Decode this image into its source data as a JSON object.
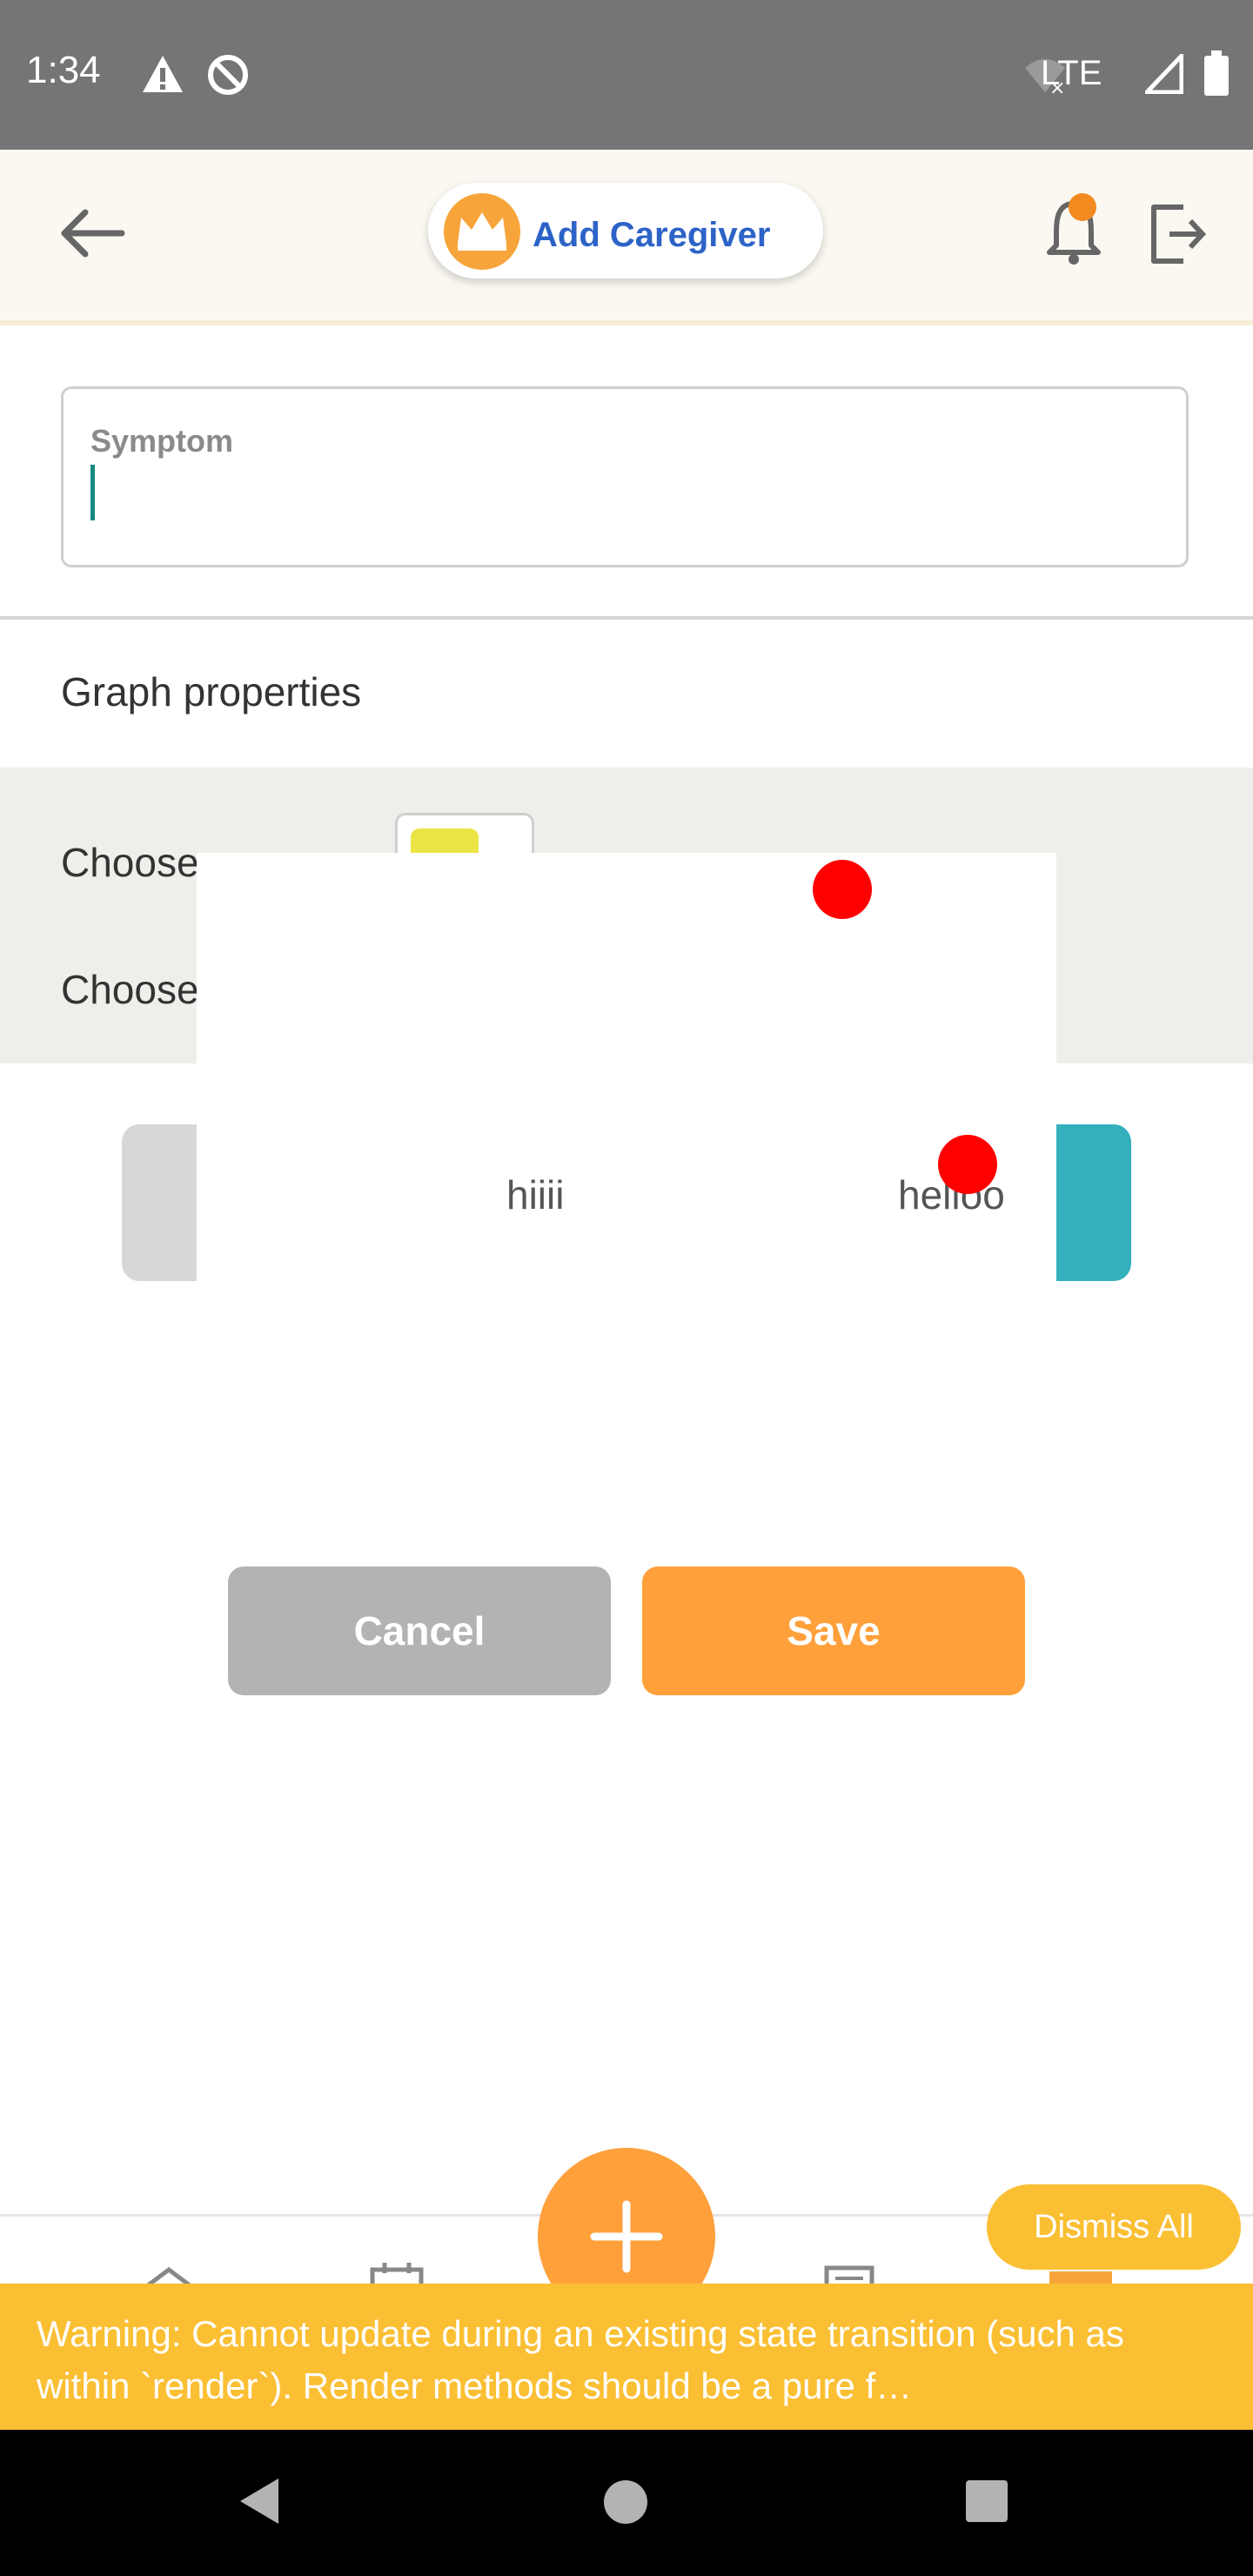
{
  "status_bar": {
    "time": "1:34",
    "network": "LTE",
    "icons": [
      "warning-icon",
      "no-sync-icon",
      "wifi-off-icon",
      "signal-icon",
      "battery-icon"
    ]
  },
  "header": {
    "back_icon": "back-arrow-icon",
    "add_caregiver_label": "Add Caregiver",
    "crown_icon": "crown-icon",
    "bell_icon": "bell-icon",
    "logout_icon": "logout-icon"
  },
  "form": {
    "symptom_label": "Symptom",
    "symptom_value": "",
    "graph_properties_label": "Graph properties",
    "choose_color_label_partial": "Choose c",
    "choose_other_label_partial": "Choose"
  },
  "modal": {
    "option_1": "hiiii",
    "option_2": "helloo"
  },
  "buttons": {
    "cancel": "Cancel",
    "save": "Save"
  },
  "bottom": {
    "fab_icon": "plus-icon",
    "dismiss_all": "Dismiss All"
  },
  "warning": {
    "text": "Warning: Cannot update during an existing state transition (such as within `render`). Render methods should be a pure f…"
  },
  "colors": {
    "accent": "#ffa03b",
    "teal": "#33b0bc",
    "warning": "#fbbf33",
    "link_blue": "#2d63c7"
  }
}
